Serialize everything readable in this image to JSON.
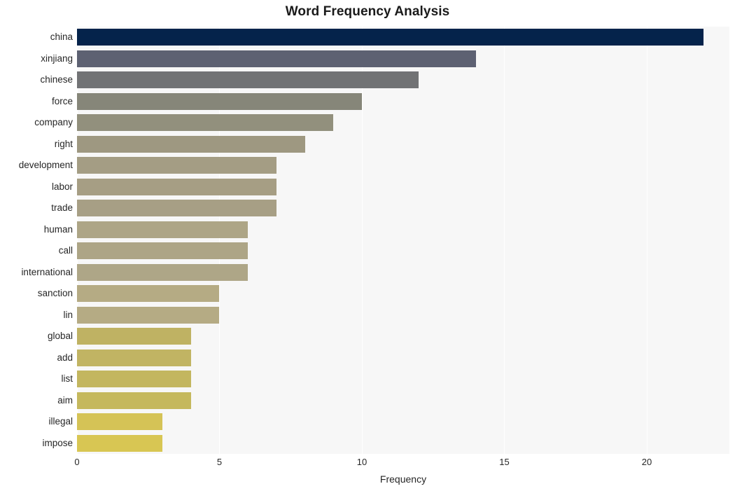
{
  "chart_data": {
    "type": "bar",
    "orientation": "horizontal",
    "title": "Word Frequency Analysis",
    "xlabel": "Frequency",
    "ylabel": "",
    "xlim": [
      0,
      22.9
    ],
    "xticks": [
      0,
      5,
      10,
      15,
      20
    ],
    "xtick_labels": [
      "0",
      "5",
      "10",
      "15",
      "20"
    ],
    "grid": "vertical-only",
    "legend": "none",
    "categories": [
      "china",
      "xinjiang",
      "chinese",
      "force",
      "company",
      "right",
      "development",
      "labor",
      "trade",
      "human",
      "call",
      "international",
      "sanction",
      "lin",
      "global",
      "add",
      "list",
      "aim",
      "illegal",
      "impose"
    ],
    "values": [
      22,
      14,
      12,
      10,
      9,
      8,
      7,
      7,
      7,
      6,
      6,
      6,
      5,
      5,
      4,
      4,
      4,
      4,
      3,
      3
    ],
    "bar_colors": [
      "#05234b",
      "#5d6172",
      "#727375",
      "#868679",
      "#92907d",
      "#9e9881",
      "#a49d84",
      "#a69e84",
      "#a79f85",
      "#ada586",
      "#ada586",
      "#aea687",
      "#b5ab84",
      "#b5ab84",
      "#bfb263",
      "#c1b463",
      "#c3b65f",
      "#c5b85d",
      "#d5c356",
      "#d8c653"
    ],
    "plot_background": "#f7f7f7",
    "gridline_color": "#ffffff",
    "title_color": "#1a1a1a",
    "tick_label_color": "#262626"
  }
}
